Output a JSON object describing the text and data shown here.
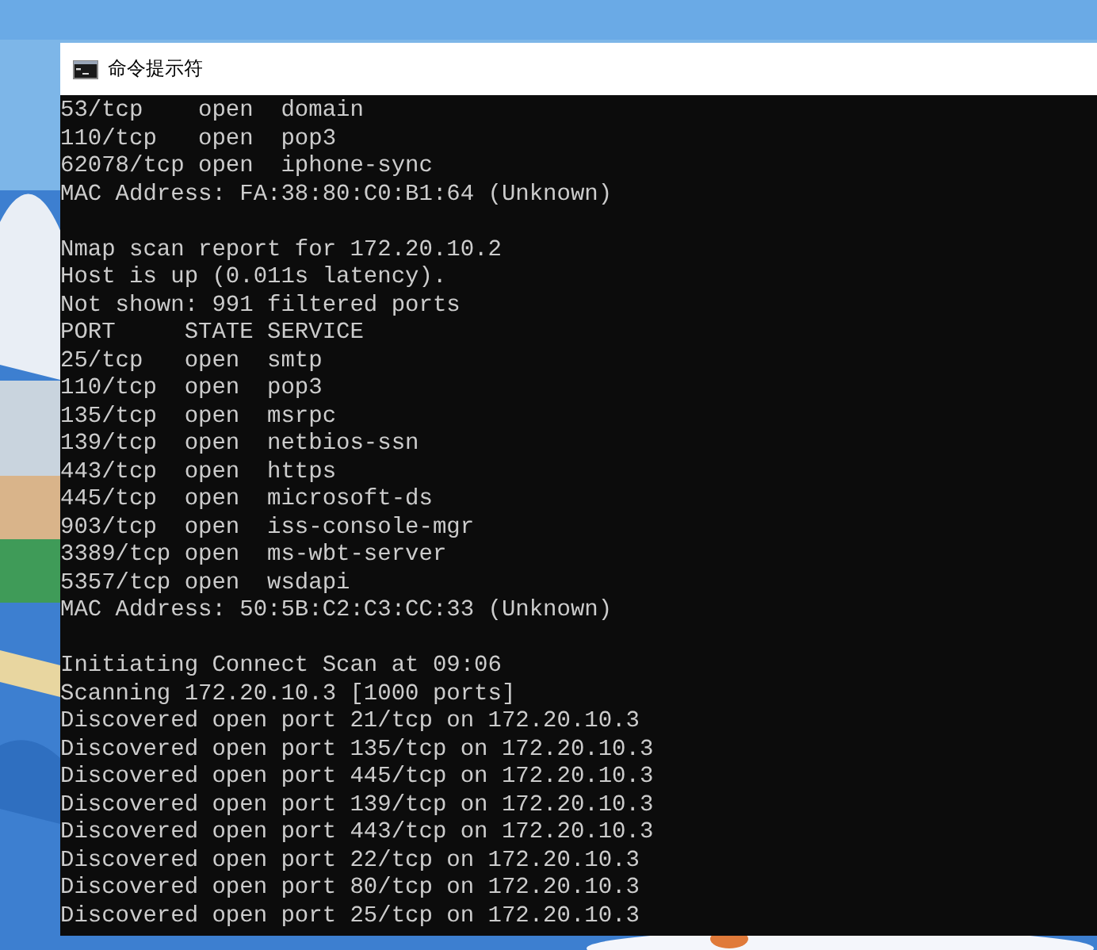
{
  "window": {
    "title": "命令提示符"
  },
  "console": {
    "blocks": [
      {
        "lines": [
          "53/tcp    open  domain",
          "110/tcp   open  pop3",
          "62078/tcp open  iphone-sync",
          "MAC Address: FA:38:80:C0:B1:64 (Unknown)"
        ]
      },
      {
        "lines": [
          "Nmap scan report for 172.20.10.2",
          "Host is up (0.011s latency).",
          "Not shown: 991 filtered ports",
          "PORT     STATE SERVICE",
          "25/tcp   open  smtp",
          "110/tcp  open  pop3",
          "135/tcp  open  msrpc",
          "139/tcp  open  netbios-ssn",
          "443/tcp  open  https",
          "445/tcp  open  microsoft-ds",
          "903/tcp  open  iss-console-mgr",
          "3389/tcp open  ms-wbt-server",
          "5357/tcp open  wsdapi",
          "MAC Address: 50:5B:C2:C3:CC:33 (Unknown)"
        ]
      },
      {
        "lines": [
          "Initiating Connect Scan at 09:06",
          "Scanning 172.20.10.3 [1000 ports]",
          "Discovered open port 21/tcp on 172.20.10.3",
          "Discovered open port 135/tcp on 172.20.10.3",
          "Discovered open port 445/tcp on 172.20.10.3",
          "Discovered open port 139/tcp on 172.20.10.3",
          "Discovered open port 443/tcp on 172.20.10.3",
          "Discovered open port 22/tcp on 172.20.10.3",
          "Discovered open port 80/tcp on 172.20.10.3",
          "Discovered open port 25/tcp on 172.20.10.3"
        ]
      }
    ]
  }
}
